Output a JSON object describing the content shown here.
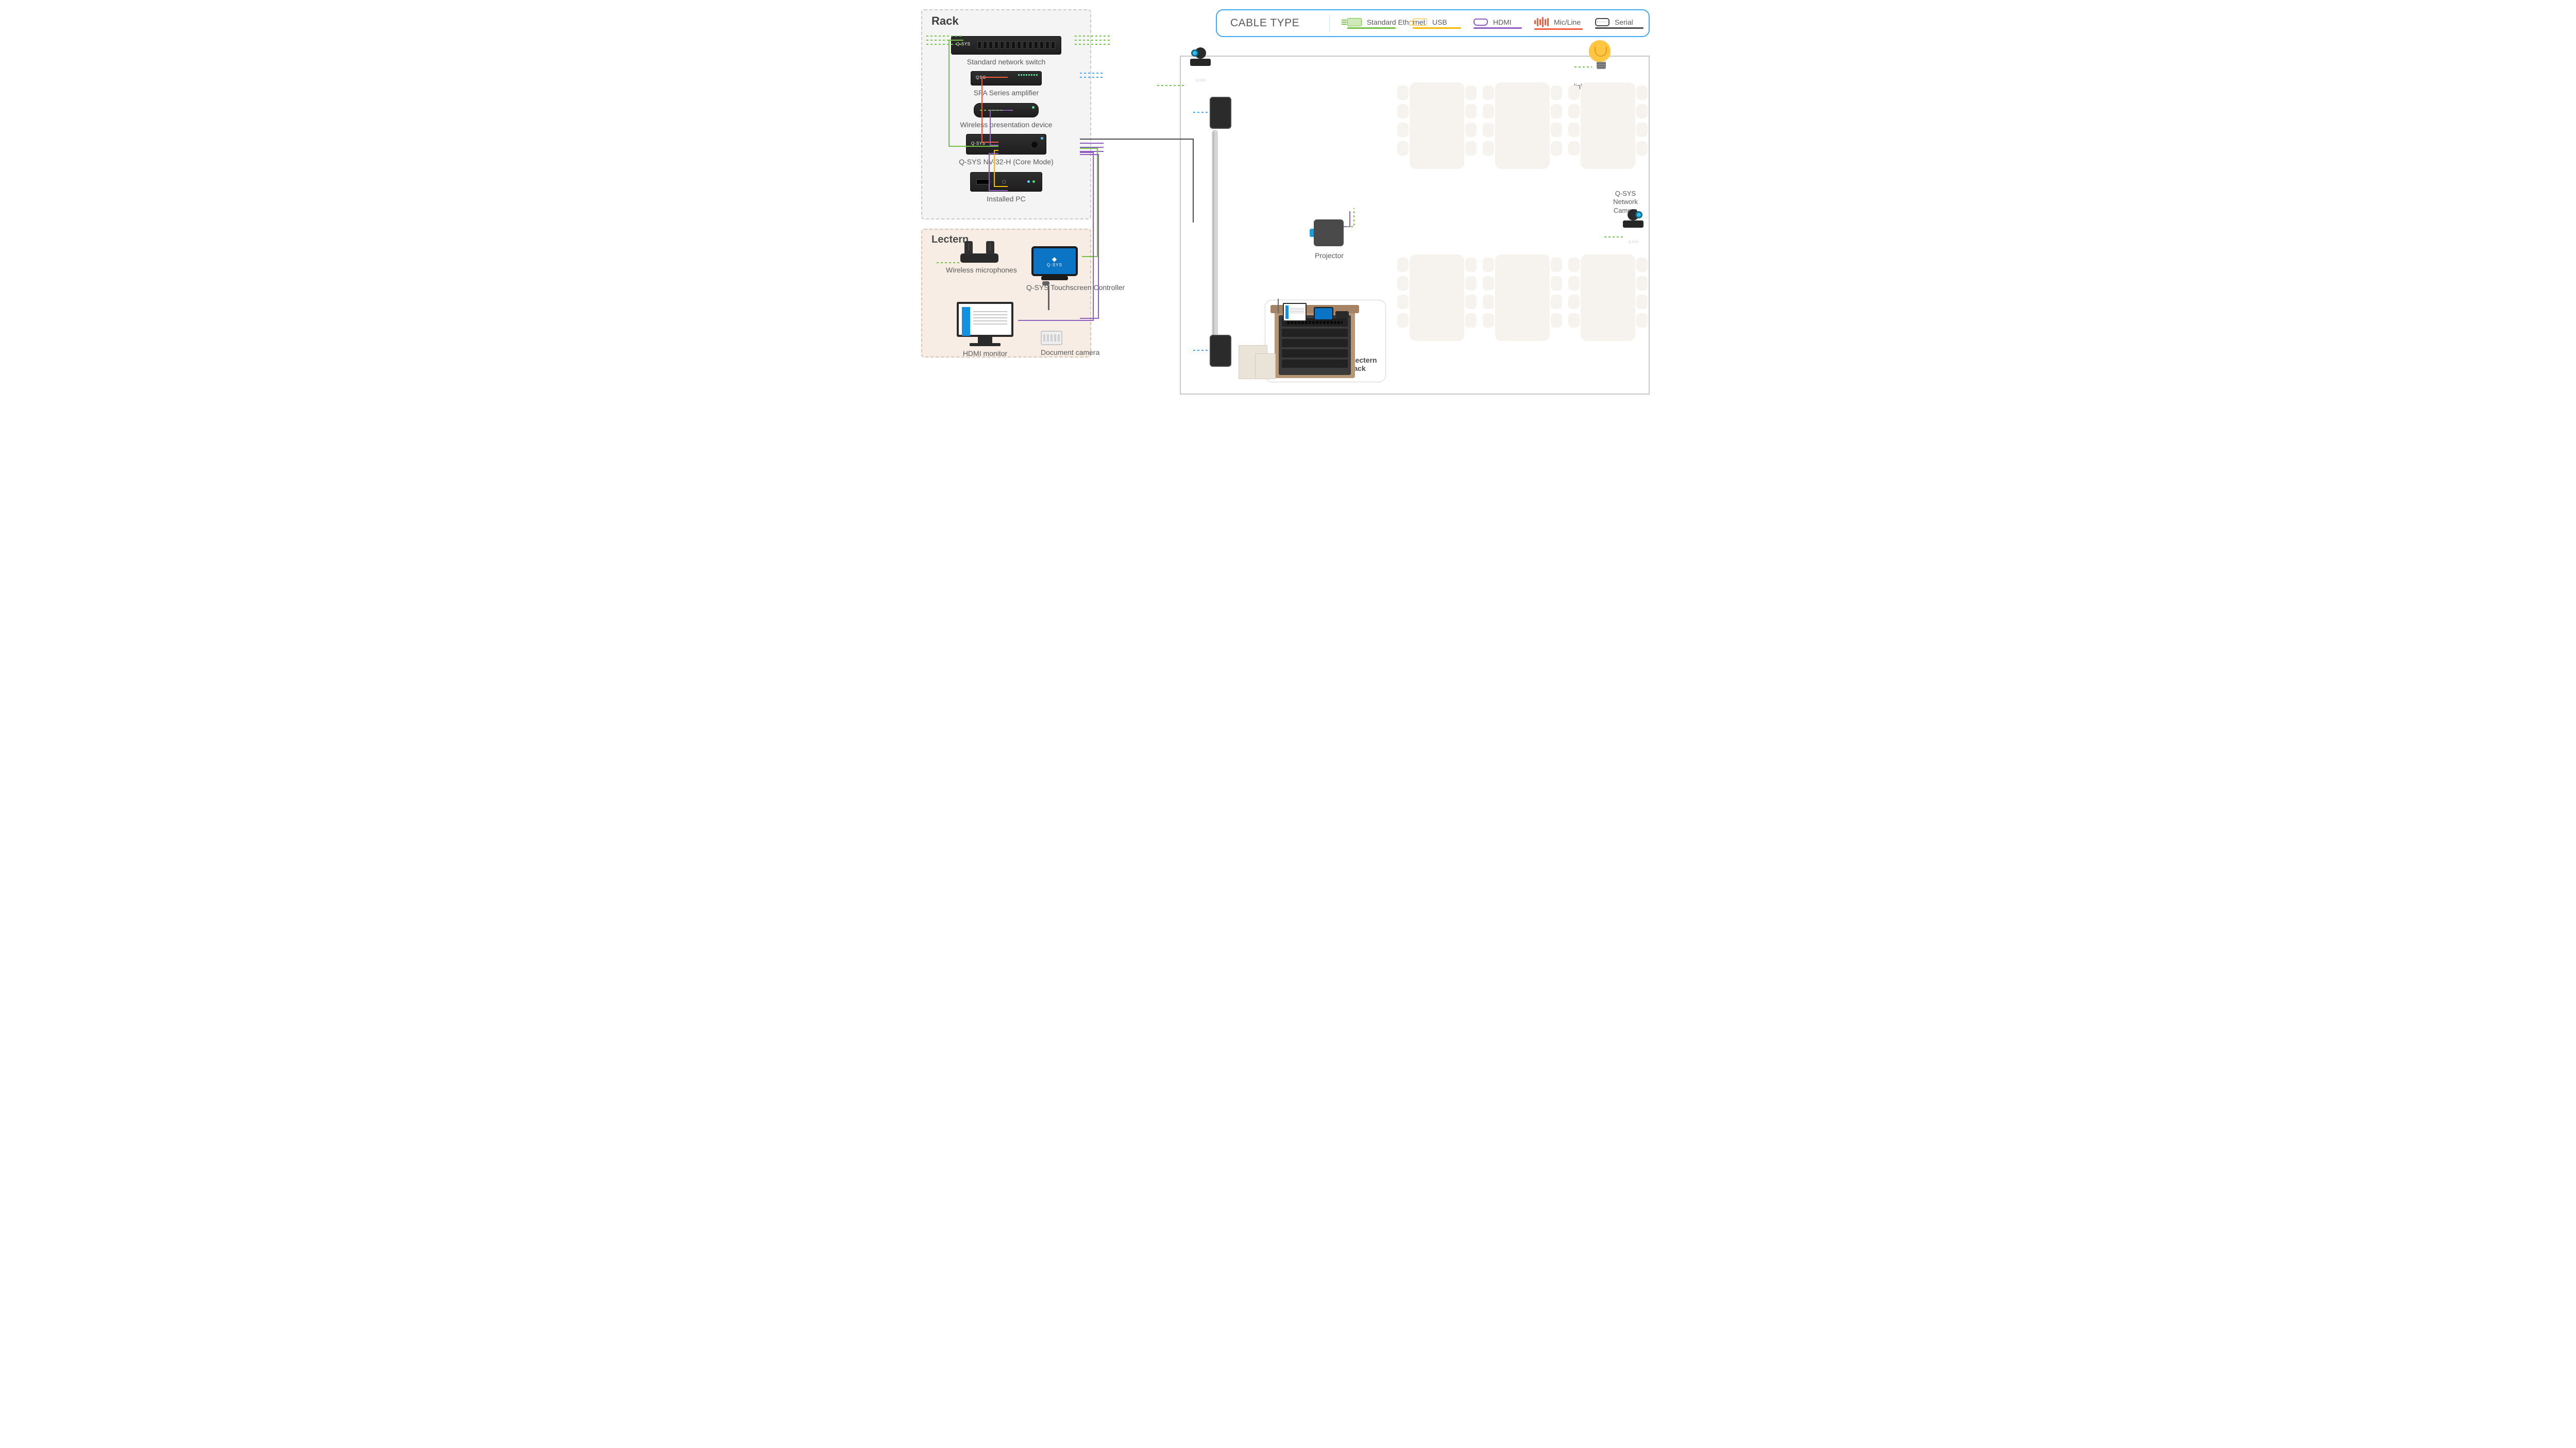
{
  "legend": {
    "title": "CABLE TYPE",
    "items": {
      "ethernet": "Standard Ethernet",
      "usb": "USB",
      "hdmi": "HDMI",
      "micline": "Mic/Line",
      "serial": "Serial"
    }
  },
  "rack": {
    "title": "Rack",
    "switch": {
      "label": "Standard network switch",
      "brand": "Q·SYS"
    },
    "amp": {
      "label": "SPA Series amplifier",
      "brand": "QSC"
    },
    "wireless_presentation": {
      "label": "Wireless presentation device"
    },
    "nv32": {
      "label": "Q-SYS NV-32-H (Core Mode)",
      "brand": "Q·SYS"
    },
    "pc": {
      "label": "Installed PC"
    }
  },
  "lectern": {
    "title": "Lectern",
    "mics": {
      "label": "Wireless microphones"
    },
    "touchscreen": {
      "label": "Q-SYS Touchscreen Controller",
      "brand": "Q·SYS"
    },
    "monitor": {
      "label": "HDMI monitor"
    },
    "doc_cam": {
      "label": "Document camera"
    }
  },
  "room": {
    "lighting": {
      "label": "lighting control via TCP/IP"
    },
    "camera": {
      "label": "Q-SYS Network Camera"
    },
    "projector": {
      "label": "Projector"
    },
    "lectern_rack": {
      "label": "Lectern rack"
    }
  },
  "cables": {
    "types": [
      "ethernet",
      "usb",
      "hdmi",
      "mic/line",
      "serial"
    ],
    "camera_front": [
      "ethernet"
    ],
    "camera_rear": [
      "ethernet"
    ],
    "lighting": [
      "ethernet"
    ],
    "speaker_top": [
      "speaker-line"
    ],
    "speaker_bottom": [
      "speaker-line"
    ],
    "projector": [
      "hdmi",
      "ethernet"
    ],
    "switch_left": [
      "ethernet",
      "ethernet",
      "ethernet"
    ],
    "switch_right": [
      "ethernet",
      "ethernet",
      "ethernet"
    ],
    "amp": [
      "speaker-line",
      "speaker-line",
      "mic/line"
    ],
    "wireless_presentation_to_nv32": [
      "hdmi"
    ],
    "wireless_presentation_external": [
      "ethernet"
    ],
    "nv32_to_pc": [
      "usb",
      "hdmi"
    ],
    "nv32_to_amp": [
      "mic/line"
    ],
    "nv32_to_switch": [
      "ethernet"
    ],
    "nv32_to_room": [
      "serial"
    ],
    "nv32_right": [
      "hdmi",
      "hdmi",
      "hdmi"
    ],
    "touchscreen": [
      "ethernet"
    ],
    "wireless_mics": [
      "ethernet"
    ],
    "hdmi_monitor": [
      "hdmi"
    ],
    "document_camera": [
      "hdmi"
    ]
  },
  "colors": {
    "ethernet": "#76c043",
    "usb": "#f5b800",
    "hdmi": "#8e5fbf",
    "mic_line": "#f25c3b",
    "serial": "#4a4a4a",
    "accent_blue": "#3fa9f5",
    "bulb": "#ffc642"
  },
  "layout": {
    "seating": {
      "table_columns": 3,
      "table_rows": 2,
      "seats_per_table_side": 4
    }
  }
}
